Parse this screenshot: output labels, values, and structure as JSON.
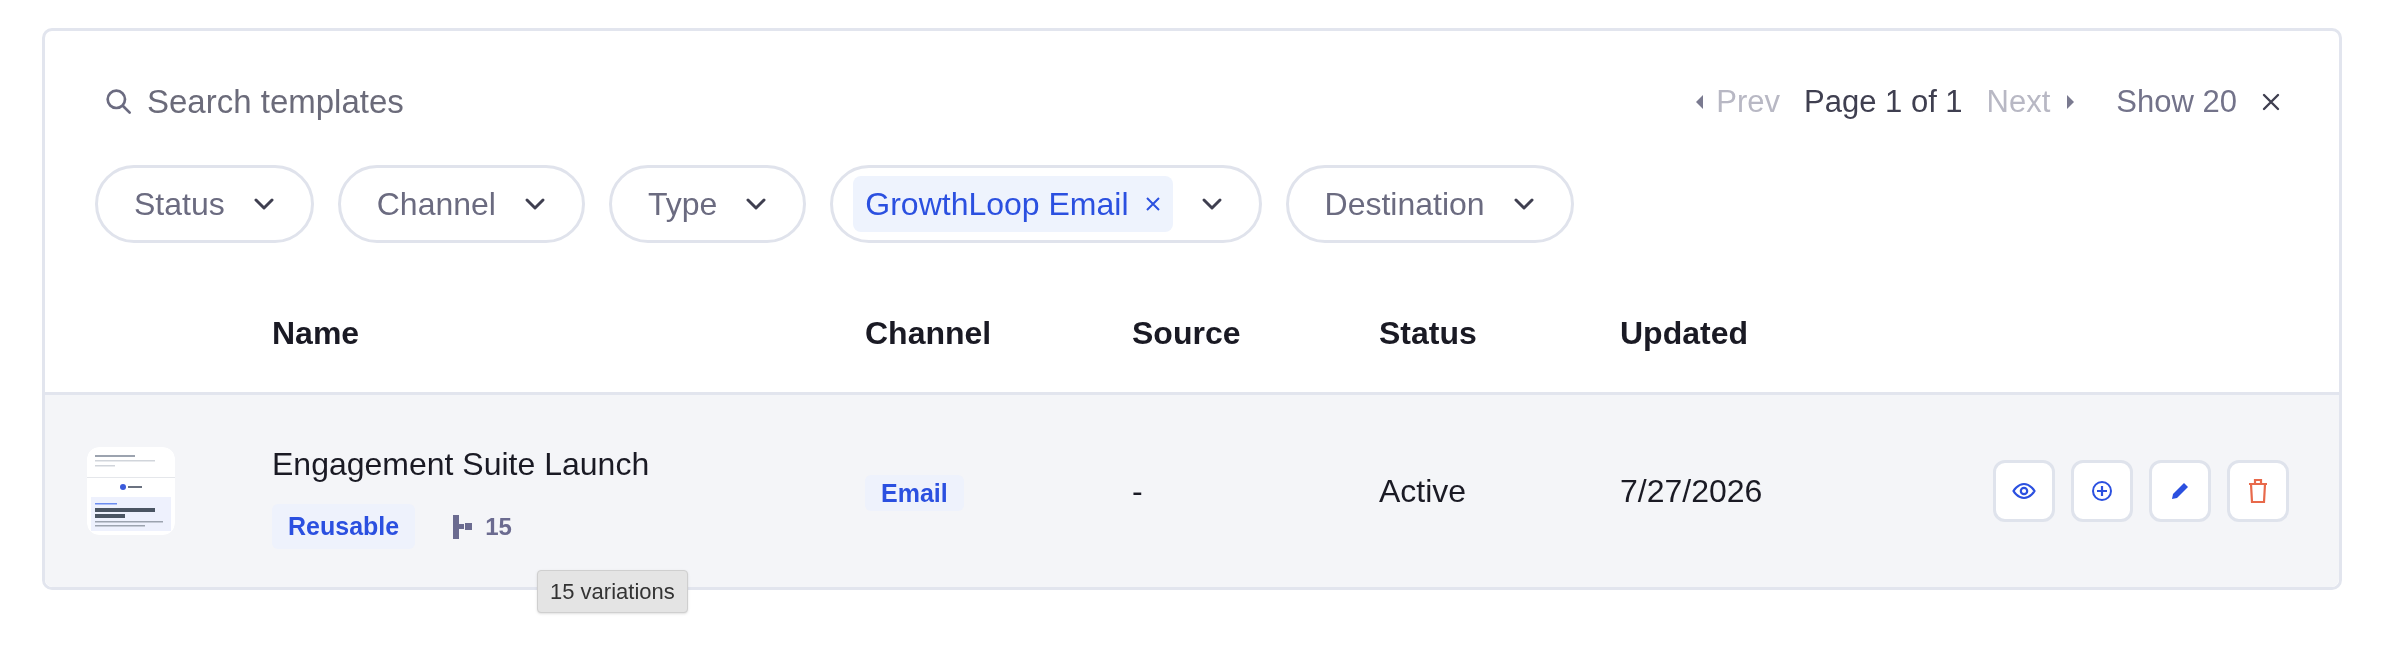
{
  "search": {
    "placeholder": "Search templates"
  },
  "pagination": {
    "prev": {
      "label": "Prev",
      "disabled": true
    },
    "page": "Page 1 of 1",
    "next": {
      "label": "Next",
      "disabled": true
    },
    "show": "Show 20"
  },
  "filters": [
    {
      "label": "Status"
    },
    {
      "label": "Channel"
    },
    {
      "label": "Type"
    },
    {
      "values": [
        "GrowthLoop Email"
      ]
    },
    {
      "label": "Destination"
    }
  ],
  "table": {
    "columns": [
      "",
      "Name",
      "Channel",
      "Source",
      "Status",
      "Updated"
    ],
    "rows": [
      {
        "name": "Engagement Suite Launch",
        "tag": "Reusable",
        "variations": "15",
        "channel": "Email",
        "source": "-",
        "status": "Active",
        "updated": "7/27/2026"
      }
    ]
  },
  "tooltip": "15 variations"
}
